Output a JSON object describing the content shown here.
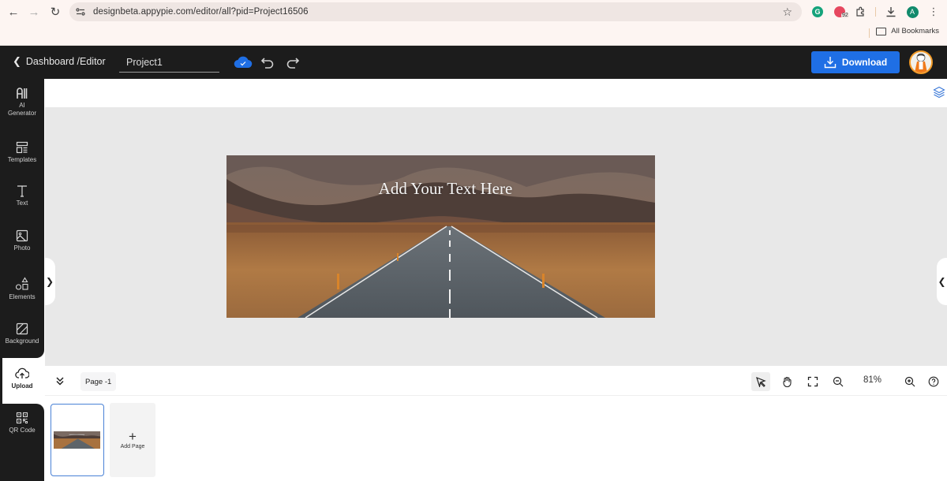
{
  "browser": {
    "url": "designbeta.appypie.com/editor/all?pid=Project16506",
    "extension_badge": "92",
    "profile_initial": "A",
    "bookmarks_label": "All Bookmarks"
  },
  "topbar": {
    "back_label": "Dashboard /Editor",
    "project_name": "Project1",
    "download_label": "Download",
    "accent_color": "#1f6fe5"
  },
  "sidebar": {
    "items": [
      {
        "label": "AI Generator",
        "icon": "ai-generator-icon"
      },
      {
        "label": "Templates",
        "icon": "templates-icon"
      },
      {
        "label": "Text",
        "icon": "text-icon"
      },
      {
        "label": "Photo",
        "icon": "photo-icon"
      },
      {
        "label": "Elements",
        "icon": "elements-icon"
      },
      {
        "label": "Background",
        "icon": "background-icon"
      },
      {
        "label": "Upload",
        "icon": "upload-icon",
        "active": true
      },
      {
        "label": "QR Code",
        "icon": "qr-code-icon"
      }
    ]
  },
  "canvas": {
    "design_text": "Add Your Text Here",
    "background_image": "mountain road landscape"
  },
  "bottom": {
    "page_label": "Page -1",
    "zoom_level": "81%",
    "add_page_label": "Add Page"
  }
}
